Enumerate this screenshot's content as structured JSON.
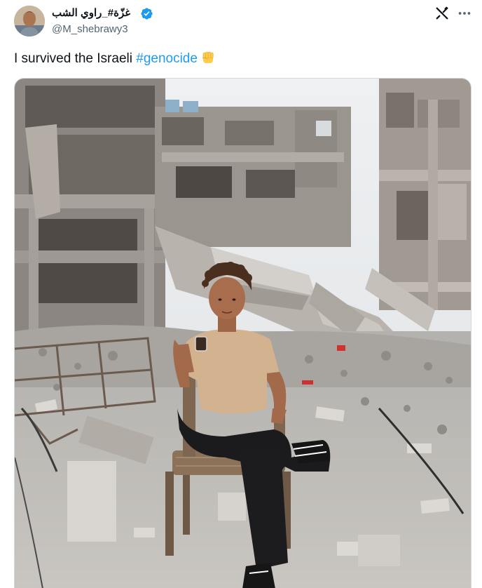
{
  "author": {
    "display_name": "غزّة#_راوي الشب",
    "handle": "@M_shebrawy3",
    "verified": true
  },
  "post": {
    "text_prefix": "I survived the Israeli ",
    "hashtag": "#genocide",
    "emoji": "raised-fist-emoji"
  },
  "media": {
    "type": "photo"
  },
  "colors": {
    "link": "#1d9bf0",
    "verified": "#1d9bf0",
    "text": "#0f1419",
    "secondary": "#536471"
  }
}
